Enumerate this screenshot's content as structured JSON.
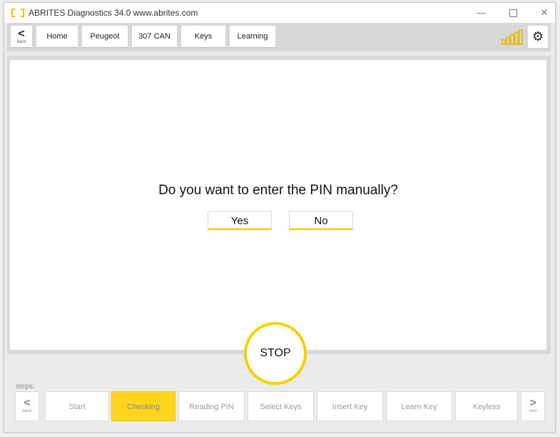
{
  "window": {
    "title": "ABRITES Diagnostics 34.0   www.abrites.com",
    "minimize_glyph": "—",
    "close_glyph": "✕"
  },
  "toolbar": {
    "back_glyph": "<",
    "back_label": "back",
    "breadcrumbs": [
      "Home",
      "Peugeot",
      "307 CAN",
      "Keys",
      "Learning"
    ],
    "settings_glyph": "⚙",
    "signal_icon": "signal-strength-icon"
  },
  "dialog": {
    "question": "Do you want to enter the PIN manually?",
    "yes_label": "Yes",
    "no_label": "No"
  },
  "stop": {
    "label": "STOP"
  },
  "steps": {
    "label": "steps:",
    "back_glyph": "<",
    "back_label": "back",
    "next_glyph": ">",
    "next_label": "next",
    "items": [
      "Start",
      "Checking",
      "Reading PIN",
      "Select Keys",
      "Insert Key",
      "Learn Key",
      "Keyless"
    ],
    "active": "Checking"
  },
  "colors": {
    "accent": "#f5c400",
    "active_step": "#ffd41c",
    "signal": "#e8b400"
  }
}
